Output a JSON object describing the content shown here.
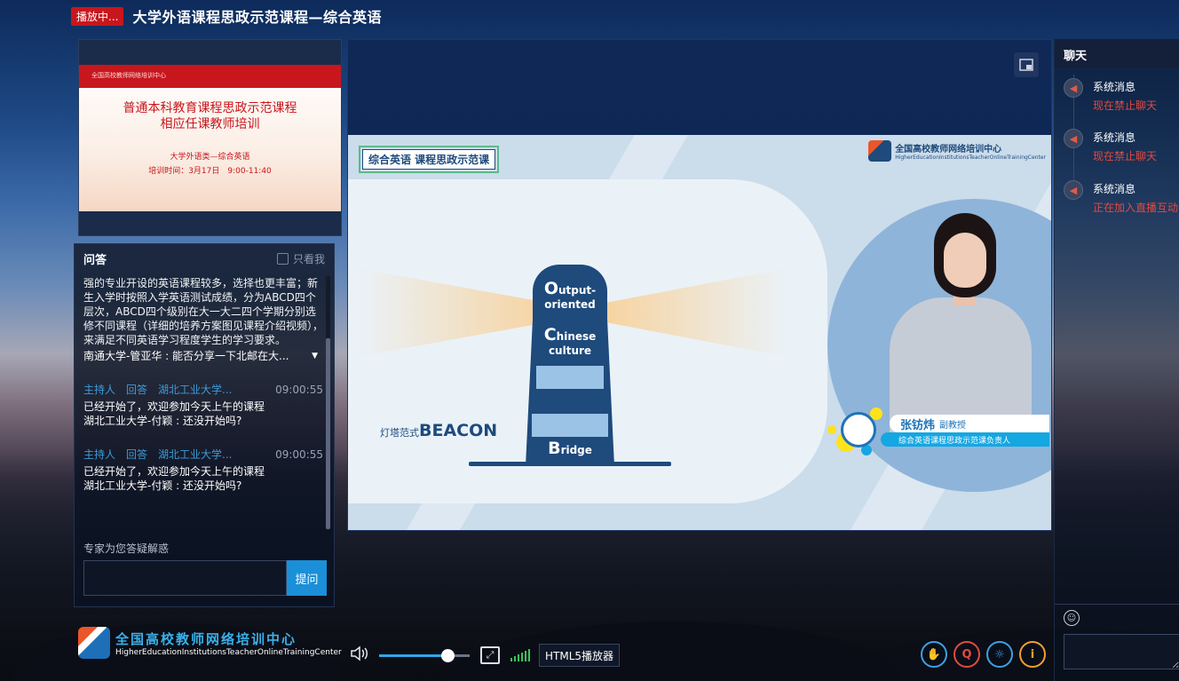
{
  "header": {
    "live_badge": "播放中...",
    "title": "大学外语课程思政示范课程—综合英语"
  },
  "slide_thumbnail": {
    "org_text": "全国高校教师网络培训中心",
    "heading_line1": "普通本科教育课程思政示范课程",
    "heading_line2": "相应任课教师培训",
    "subtitle": "大学外语类—综合英语",
    "time": "培训时间：3月17日　9:00-11:40"
  },
  "qa": {
    "title": "问答",
    "only_me_label": "只看我",
    "first_answer": "强的专业开设的英语课程较多，选择也更丰富；新生入学时按照入学英语测试成绩，分为ABCD四个层次，ABCD四个级别在大一大二四个学期分别选修不同课程（详细的培养方案图见课程介绍视频），来满足不同英语学习程度学生的学习要求。",
    "first_question": "南通大学-管亚华 : 能否分享一下北邮在大...",
    "items": [
      {
        "meta": "主持人　回答　湖北工业大学...",
        "time": "09:00:55",
        "answer": "已经开始了，欢迎参加今天上午的课程",
        "question": "湖北工业大学-付颖 : 还没开始吗?"
      },
      {
        "meta": "主持人　回答　湖北工业大学...",
        "time": "09:00:55",
        "answer": "已经开始了，欢迎参加今天上午的课程",
        "question": "湖北工业大学-付颖 : 还没开始吗?"
      }
    ],
    "expert_label": "专家为您答疑解惑",
    "ask_input_placeholder": "",
    "ask_button": "提问"
  },
  "video": {
    "tag": "综合英语 课程思政示范课",
    "logo_cn": "全国高校教师网络培训中心",
    "logo_en": "HigherEducationInstitutionsTeacherOnlineTrainingCenter",
    "beacon_small": "灯塔范式",
    "beacon_big": "BEACON",
    "tower_o_letter": "O",
    "tower_o_rest": "utput-",
    "tower_o_line2": "oriented",
    "tower_c_letter": "C",
    "tower_c_rest": "hinese culture",
    "tower_b_letter": "B",
    "tower_b_rest": "ridge",
    "presenter_name": "张钫炜",
    "presenter_title": "副教授",
    "presenter_role": "综合英语课程思政示范课负责人"
  },
  "chat": {
    "title": "聊天",
    "messages": [
      {
        "from": "系统消息",
        "text": "现在禁止聊天"
      },
      {
        "from": "系统消息",
        "text": "现在禁止聊天"
      },
      {
        "from": "系统消息",
        "text": "正在加入直播互动"
      }
    ]
  },
  "bottom": {
    "logo_cn": "全国高校教师网络培训中心",
    "logo_en": "HigherEducationInstitutionsTeacherOnlineTrainingCenter",
    "player_mode": "HTML5播放器",
    "volume_level": 0.75,
    "icons": [
      "raise-hand-icon",
      "qa-icon",
      "settings-icon",
      "info-icon"
    ]
  },
  "colors": {
    "live_red": "#c8161d",
    "accent_blue": "#1b8fd8",
    "link_blue": "#3d9bd8",
    "system_red": "#e24a3f"
  }
}
